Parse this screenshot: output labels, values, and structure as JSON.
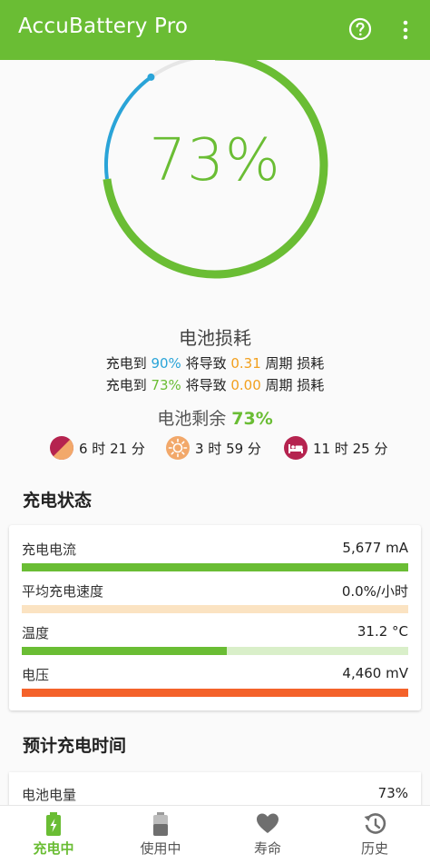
{
  "app": {
    "title": "AccuBattery Pro"
  },
  "gauge": {
    "percent_text": "73%",
    "charge_fraction": 0.73,
    "target_fraction": 0.9
  },
  "wear": {
    "title": "电池损耗",
    "line1": {
      "prefix": "充电到 ",
      "percent": "90%",
      "mid": " 将导致 ",
      "cycles": "0.31",
      "suffix": " 周期 损耗"
    },
    "line2": {
      "prefix": "充电到 ",
      "percent": "73%",
      "mid": " 将导致 ",
      "cycles": "0.00",
      "suffix": " 周期 损耗"
    }
  },
  "remaining": {
    "label": "电池剩余 ",
    "value": "73%"
  },
  "estimates": [
    {
      "icon": "screen-on-icon",
      "text": "6 时 21 分"
    },
    {
      "icon": "screen-off-icon",
      "text": "3 时 59 分"
    },
    {
      "icon": "sleep-icon",
      "text": "11 时 25 分"
    }
  ],
  "charging_status": {
    "title": "充电状态",
    "rows": [
      {
        "label": "充电电流",
        "value": "5,677 mA",
        "fill": 1.0,
        "color": "#6abd34",
        "track": "#d9efc9"
      },
      {
        "label": "平均充电速度",
        "value": "0.0%/小时",
        "fill": 0.0,
        "color": "#f2a01e",
        "track": "#fbe3c2"
      },
      {
        "label": "温度",
        "value": "31.2 °C",
        "fill": 0.53,
        "color": "#6abd34",
        "track": "#d9efc9"
      },
      {
        "label": "电压",
        "value": "4,460 mV",
        "fill": 1.0,
        "color": "#f4622a",
        "track": "#fcd2c2"
      }
    ]
  },
  "estimate_section": {
    "title": "预计充电时间",
    "row": {
      "label": "电池电量",
      "value": "73%"
    }
  },
  "nav": [
    {
      "label": "充电中",
      "icon": "charging-battery-icon",
      "active": true
    },
    {
      "label": "使用中",
      "icon": "battery-icon",
      "active": false
    },
    {
      "label": "寿命",
      "icon": "heart-icon",
      "active": false
    },
    {
      "label": "历史",
      "icon": "history-icon",
      "active": false
    }
  ],
  "colors": {
    "accent": "#6abd34",
    "blue": "#2aa4d8",
    "orange": "#f2a01e",
    "red": "#f4622a"
  }
}
